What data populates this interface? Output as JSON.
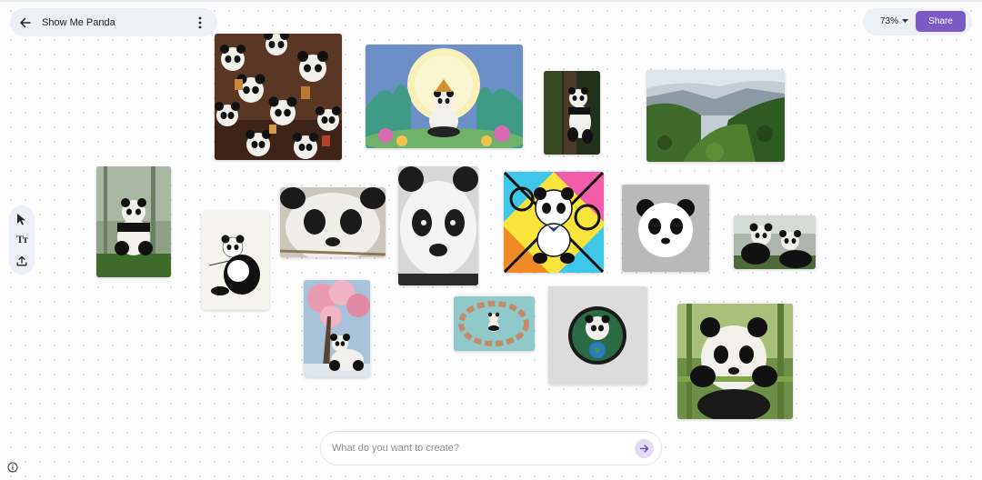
{
  "header": {
    "title": "Show Me Panda",
    "back_icon": "arrow-left-icon",
    "more_icon": "more-vert-icon"
  },
  "controls": {
    "zoom_level": "73%",
    "share_label": "Share",
    "accent_color": "#7d59c4"
  },
  "toolbar": {
    "items": [
      {
        "name": "select-tool",
        "icon": "cursor-arrow-icon"
      },
      {
        "name": "text-tool",
        "icon": "text-size-icon",
        "label": "Tт"
      },
      {
        "name": "upload-tool",
        "icon": "upload-icon"
      }
    ]
  },
  "canvas": {
    "images": [
      {
        "name": "image-panda-figurines"
      },
      {
        "name": "image-panda-moon-meditation"
      },
      {
        "name": "image-panda-climbing-tree"
      },
      {
        "name": "image-forest-valley"
      },
      {
        "name": "image-panda-sitting-forest"
      },
      {
        "name": "image-panda-ink-sketch"
      },
      {
        "name": "image-panda-face-painting"
      },
      {
        "name": "image-panda-pencil-portrait"
      },
      {
        "name": "image-panda-pop-art"
      },
      {
        "name": "image-panda-icon-gray"
      },
      {
        "name": "image-pandas-in-snow"
      },
      {
        "name": "image-panda-cherry-blossom"
      },
      {
        "name": "image-panda-hands-circle"
      },
      {
        "name": "image-panda-earth-logo"
      },
      {
        "name": "image-panda-eating-bamboo"
      }
    ]
  },
  "prompt": {
    "placeholder": "What do you want to create?",
    "value": ""
  }
}
